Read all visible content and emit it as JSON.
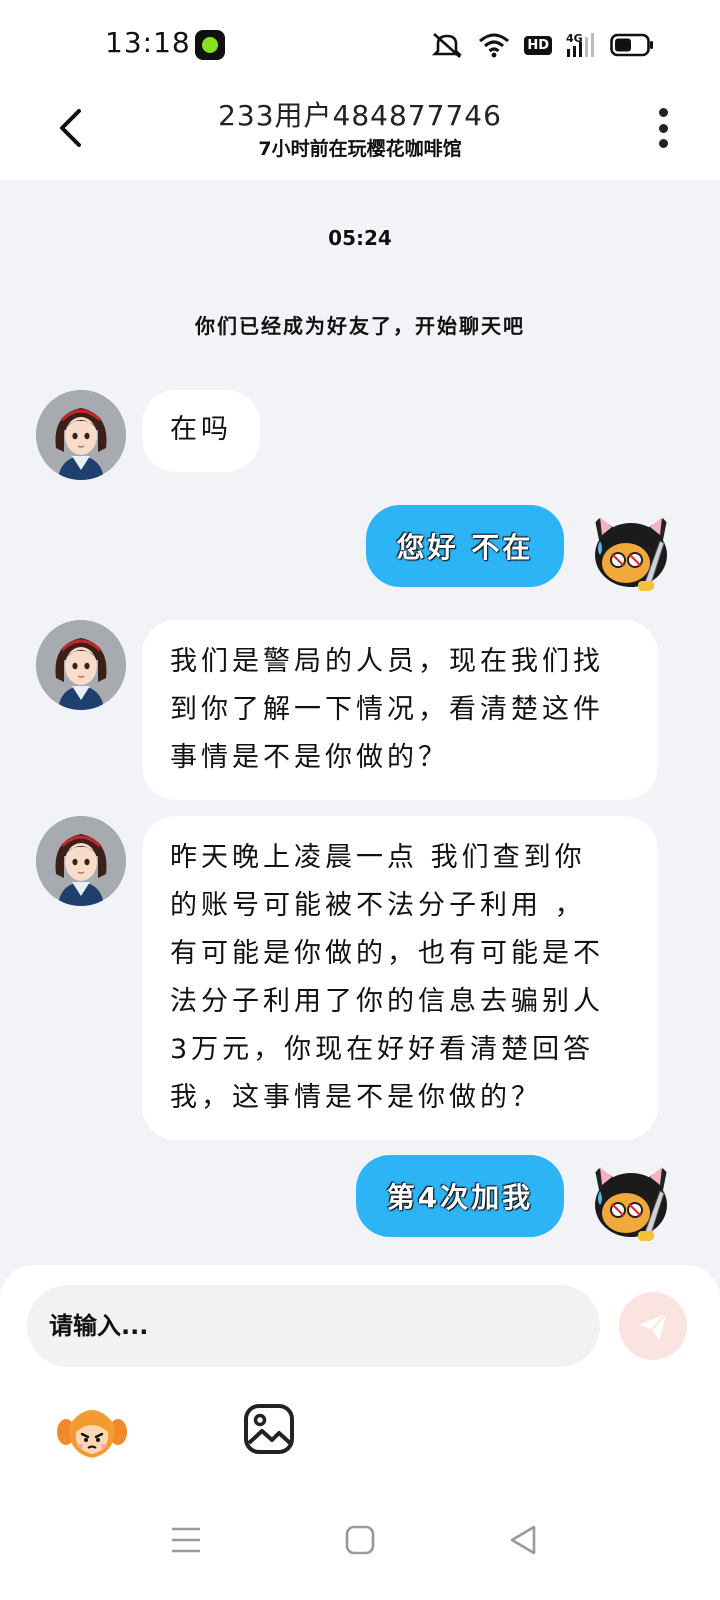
{
  "status_bar": {
    "time": "13:18",
    "icons": [
      "mute-icon",
      "wifi-icon",
      "hd-icon",
      "4g-signal-icon",
      "battery-icon"
    ],
    "hd_label": "HD",
    "network_label": "4G"
  },
  "header": {
    "title": "233用户484877746",
    "subtitle": "7小时前在玩樱花咖啡馆"
  },
  "chat": {
    "time_label": "05:24",
    "system_message": "你们已经成为好友了，开始聊天吧",
    "messages": [
      {
        "side": "in",
        "text": "在吗"
      },
      {
        "side": "out",
        "text": "您好 不在"
      },
      {
        "side": "in",
        "lines": [
          "我们是警局的人员，现在我们找",
          "到你了解一下情况，看清楚这件",
          "事情是不是你做的？"
        ]
      },
      {
        "side": "in",
        "lines": [
          "昨天晚上凌晨一点 我们查到你",
          "的账号可能被不法分子利用 ，",
          "有可能是你做的，也有可能是不",
          "法分子利用了你的信息去骗别人",
          "3万元，你现在好好看清楚回答",
          "我，这事情是不是你做的？"
        ]
      },
      {
        "side": "out",
        "text": "第4次加我"
      }
    ]
  },
  "input": {
    "placeholder": "请输入..."
  },
  "colors": {
    "background": "#f1f3f7",
    "outgoing_bubble": "#2db4f5",
    "incoming_bubble": "#ffffff",
    "send_button": "#fbe3df"
  },
  "toolbar_icons": [
    "emoji-icon",
    "image-icon"
  ],
  "nav_icons": [
    "menu-icon",
    "home-icon",
    "back-triangle-icon"
  ]
}
